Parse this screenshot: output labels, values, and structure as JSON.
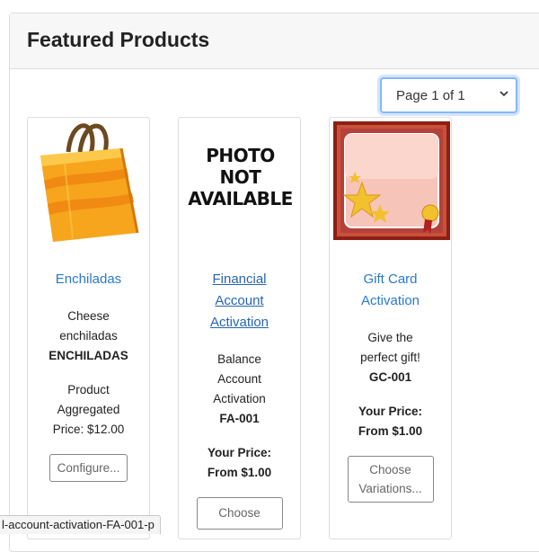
{
  "header": {
    "title": "Featured Products"
  },
  "pager": {
    "label": "Page 1 of 1"
  },
  "products": [
    {
      "name": "Enchiladas",
      "desc_lines": [
        "Cheese",
        "enchiladas"
      ],
      "sku": "ENCHILADAS",
      "price_lines": [
        "Product",
        "Aggregated",
        "Price: $12.00"
      ],
      "button": "Configure..."
    },
    {
      "image_text": [
        "PHOTO",
        "NOT",
        "AVAILABLE"
      ],
      "name_lines": [
        "Financial",
        "Account",
        "Activation"
      ],
      "desc_lines": [
        "Balance",
        "Account",
        "Activation"
      ],
      "sku": "FA-001",
      "price_label": "Your Price:",
      "price_value": "From $1.00",
      "button": "Choose"
    },
    {
      "name_lines": [
        "Gift Card",
        "Activation"
      ],
      "desc_lines": [
        "Give the",
        "perfect gift!"
      ],
      "sku": "GC-001",
      "price_label": "Your Price:",
      "price_value": "From $1.00",
      "button_lines": [
        "Choose",
        "Variations..."
      ]
    }
  ],
  "status_bar": {
    "url_fragment": "l-account-activation-FA-001-p"
  },
  "colors": {
    "link": "#2a7ac7",
    "focus_ring": "#86b7fe",
    "bag_orange": "#f7a51c"
  }
}
